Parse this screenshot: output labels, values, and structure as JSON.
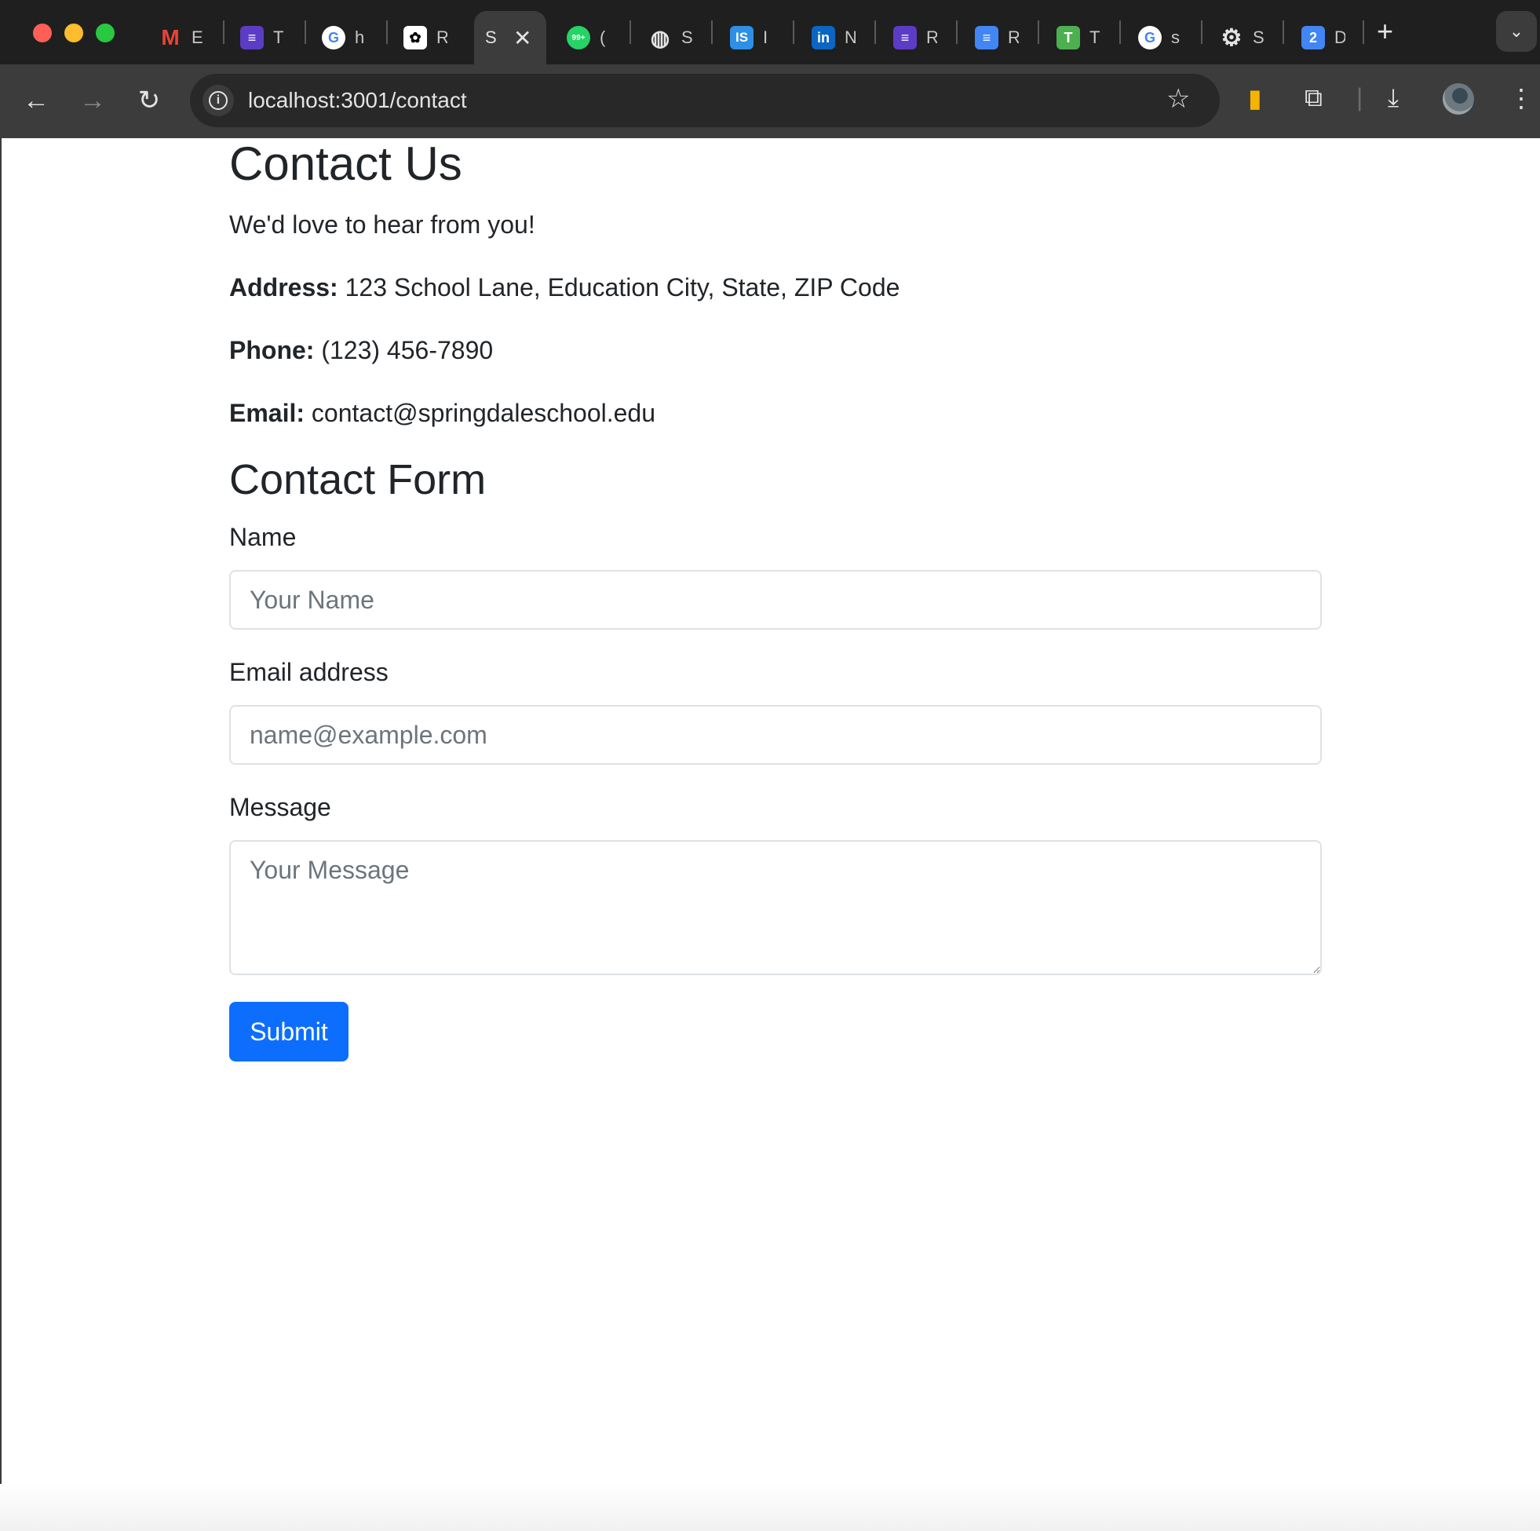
{
  "browser": {
    "tabs": [
      {
        "label": "E",
        "icon": "gmail-icon",
        "color": "#ea4335"
      },
      {
        "label": "T",
        "icon": "list-icon",
        "color": "#5b3cc4"
      },
      {
        "label": "h",
        "icon": "google-icon",
        "color": "#ffffff"
      },
      {
        "label": "R",
        "icon": "openai-icon",
        "color": "#ffffff"
      },
      {
        "label": "S",
        "icon": "",
        "color": "",
        "active": true
      },
      {
        "label": "(",
        "icon": "whatsapp-icon",
        "color": "#25d366"
      },
      {
        "label": "S",
        "icon": "globe-icon",
        "color": "#e3e3e3"
      },
      {
        "label": "I",
        "icon": "is-icon",
        "color": "#2d8fe5"
      },
      {
        "label": "N",
        "icon": "linkedin-icon",
        "color": "#0a66c2"
      },
      {
        "label": "R",
        "icon": "list-icon",
        "color": "#5b3cc4"
      },
      {
        "label": "R",
        "icon": "docs-icon",
        "color": "#4285f4"
      },
      {
        "label": "T",
        "icon": "t-icon",
        "color": "#4caf50"
      },
      {
        "label": "s",
        "icon": "google-icon",
        "color": "#ffffff"
      },
      {
        "label": "S",
        "icon": "gear-icon",
        "color": "#e3e3e3"
      },
      {
        "label": "D",
        "icon": "two-icon",
        "color": "#4285f4"
      }
    ],
    "url": "localhost:3001/contact"
  },
  "page": {
    "title": "Contact Us",
    "lead": "We'd love to hear from you!",
    "address_label": "Address:",
    "address": "123 School Lane, Education City, State, ZIP Code",
    "phone_label": "Phone:",
    "phone": "(123) 456-7890",
    "email_label": "Email:",
    "email": "contact@springdaleschool.edu",
    "form_title": "Contact Form",
    "name_label": "Name",
    "name_placeholder": "Your Name",
    "email_field_label": "Email address",
    "email_placeholder": "name@example.com",
    "message_label": "Message",
    "message_placeholder": "Your Message",
    "submit_label": "Submit"
  }
}
